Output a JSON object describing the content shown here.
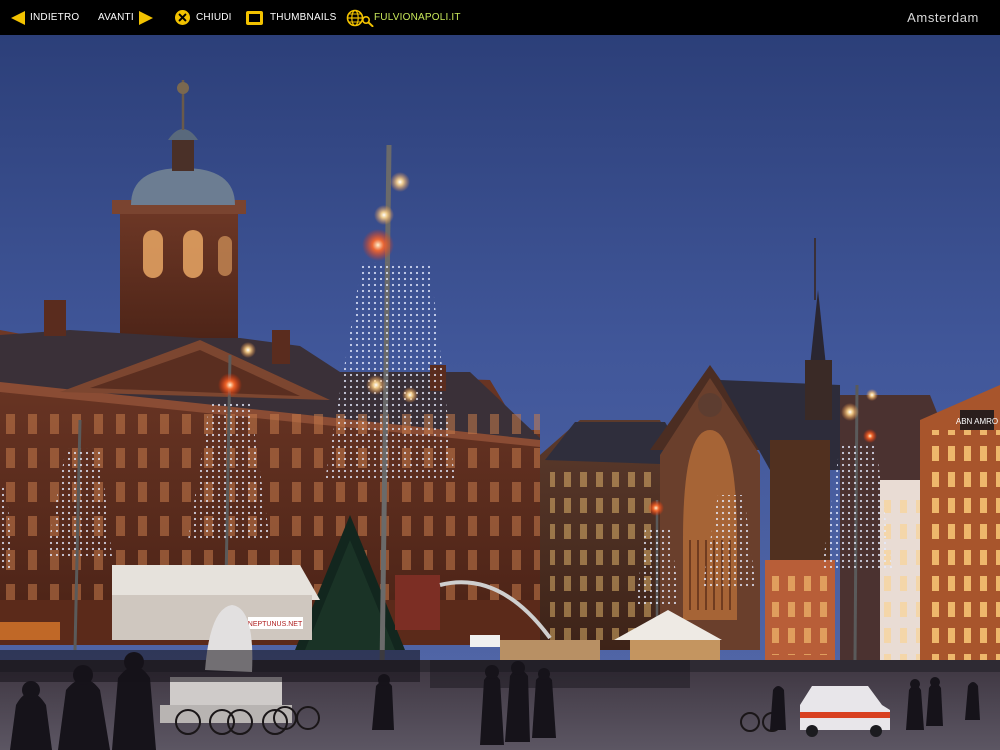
{
  "toolbar": {
    "back_label": "INDIETRO",
    "next_label": "AVANTI",
    "close_label": "CHIUDI",
    "thumbnails_label": "THUMBNAILS",
    "site_label": "FULVIONAPOLI.IT"
  },
  "photo": {
    "title": "Amsterdam",
    "signage": {
      "bank_sign": "ABN AMRO",
      "stand_sign": "NEPTUNUS.NET"
    }
  },
  "colors": {
    "accent": "#f2c200",
    "site_link": "#c9e85a",
    "bar_background": "#000000",
    "title_text": "#d8d8d8"
  },
  "icons": {
    "back": "arrow-left-icon",
    "next": "arrow-right-icon",
    "close": "close-circle-icon",
    "thumbnails": "thumbnails-icon",
    "site": "globe-search-icon"
  }
}
